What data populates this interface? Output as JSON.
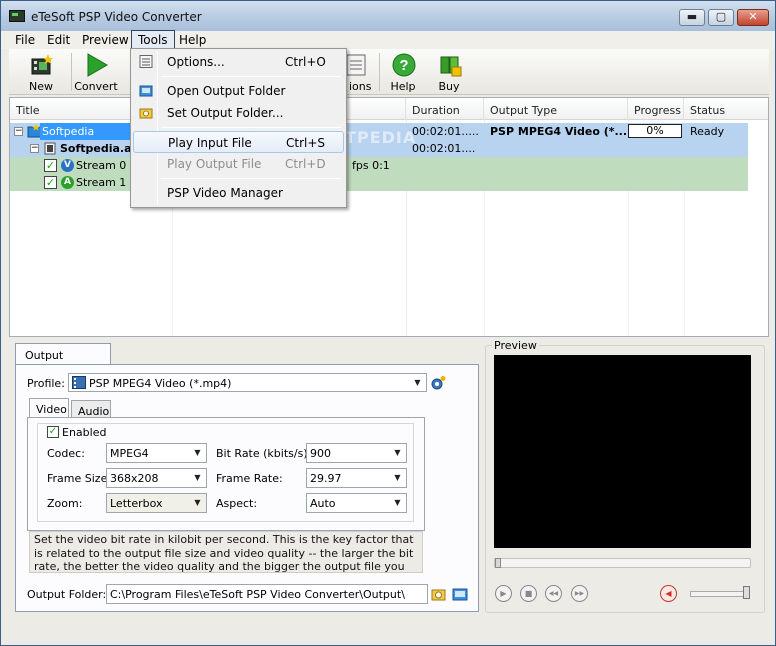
{
  "window": {
    "title": "eTeSoft PSP Video Converter",
    "minimize_glyph": "▬",
    "maximize_glyph": "▢",
    "close_glyph": "✕"
  },
  "menubar": [
    "File",
    "Edit",
    "Preview",
    "Tools",
    "Help"
  ],
  "toolbar": {
    "new": "New",
    "convert": "Convert",
    "options_partial": "ions",
    "help": "Help",
    "buy": "Buy"
  },
  "grid": {
    "columns": [
      "Title",
      "Duration",
      "Output Type",
      "Progress",
      "Status"
    ],
    "rows": [
      {
        "title": "Softpedia",
        "duration": "00:02:01.....",
        "output_type": "PSP MPEG4 Video (*....",
        "progress": "0%",
        "status": "Ready"
      },
      {
        "title": "Softpedia.av",
        "duration": "00:02:01....",
        "output_type": "",
        "progress": "",
        "status": ""
      },
      {
        "title": "Stream 0",
        "extra": "fps 0:1",
        "duration": "",
        "output_type": "",
        "progress": "",
        "status": ""
      },
      {
        "title": "Stream 1",
        "duration": "",
        "output_type": "",
        "progress": "",
        "status": ""
      }
    ],
    "tree_toggle": "−",
    "check_mark": "✓",
    "stream_video_badge": "V",
    "stream_audio_badge": "A",
    "watermark": "SOFTPEDIA"
  },
  "tools_menu": {
    "items": [
      {
        "label": "Options...",
        "shortcut": "Ctrl+O",
        "disabled": false
      },
      {
        "label": "Open Output Folder",
        "shortcut": "",
        "disabled": false
      },
      {
        "label": "Set Output Folder...",
        "shortcut": "",
        "disabled": false
      },
      {
        "label": "Play Input File",
        "shortcut": "Ctrl+S",
        "disabled": false
      },
      {
        "label": "Play Output File",
        "shortcut": "Ctrl+D",
        "disabled": true
      },
      {
        "label": "PSP Video Manager",
        "shortcut": "",
        "disabled": false
      }
    ]
  },
  "output_settings": {
    "tab_label": "Output Settings",
    "profile_label": "Profile:",
    "profile_value": "PSP MPEG4 Video (*.mp4)",
    "tabs": [
      "Video",
      "Audio"
    ],
    "enabled_label": "Enabled",
    "codec_label": "Codec:",
    "codec_value": "MPEG4",
    "bitrate_label": "Bit Rate (kbits/s):",
    "bitrate_value": "900",
    "framesize_label": "Frame Size:",
    "framesize_value": "368x208",
    "framerate_label": "Frame Rate:",
    "framerate_value": "29.97",
    "zoom_label": "Zoom:",
    "zoom_value": "Letterbox",
    "aspect_label": "Aspect:",
    "aspect_value": "Auto",
    "description": "Set the video bit rate in kilobit per second. This is the key factor that is related to the output file size and video quality -- the larger the bit rate, the better the video quality and the bigger the output file you will get, and vice versa. The last",
    "output_folder_label": "Output Folder:",
    "output_folder_value": "C:\\Program Files\\eTeSoft PSP Video Converter\\Output\\"
  },
  "preview": {
    "title": "Preview",
    "play_glyph": "▶",
    "stop_glyph": "■",
    "rewind_glyph": "◀◀",
    "forward_glyph": "▶▶",
    "mute_glyph": "◀"
  },
  "colors": {
    "selection": "#3399ff",
    "row_blue": "#b8d3ef",
    "row_green": "#bfdcbf",
    "accent_green": "#1faa1f"
  }
}
